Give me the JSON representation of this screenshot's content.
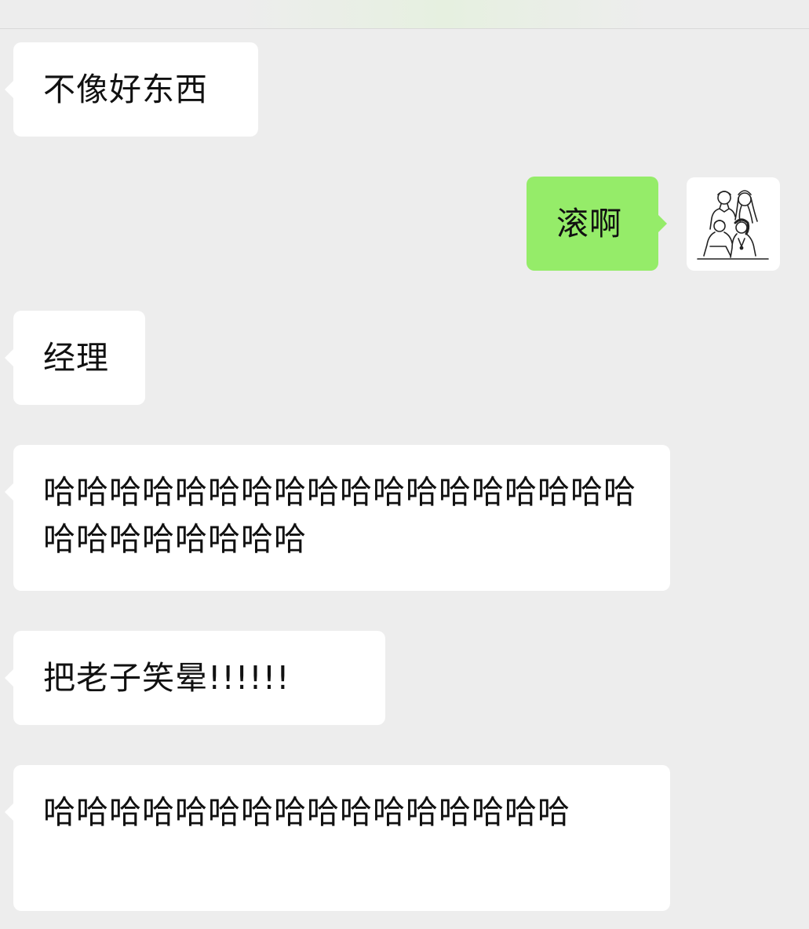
{
  "messages": [
    {
      "side": "in",
      "text": "不像好东西"
    },
    {
      "side": "out",
      "text": "滚啊",
      "avatar_icon": "family-portrait-icon"
    },
    {
      "side": "in",
      "text": "经理"
    },
    {
      "side": "in",
      "text": "哈哈哈哈哈哈哈哈哈哈哈哈哈哈哈哈哈哈哈哈哈哈哈哈哈哈"
    },
    {
      "side": "in",
      "text": "把老子笑晕!!!!!!"
    },
    {
      "side": "in",
      "text": "哈哈哈哈哈哈哈哈哈哈哈哈哈哈哈哈"
    }
  ],
  "colors": {
    "background": "#ededed",
    "incoming_bubble": "#ffffff",
    "outgoing_bubble": "#95ec69",
    "text": "#111111"
  }
}
